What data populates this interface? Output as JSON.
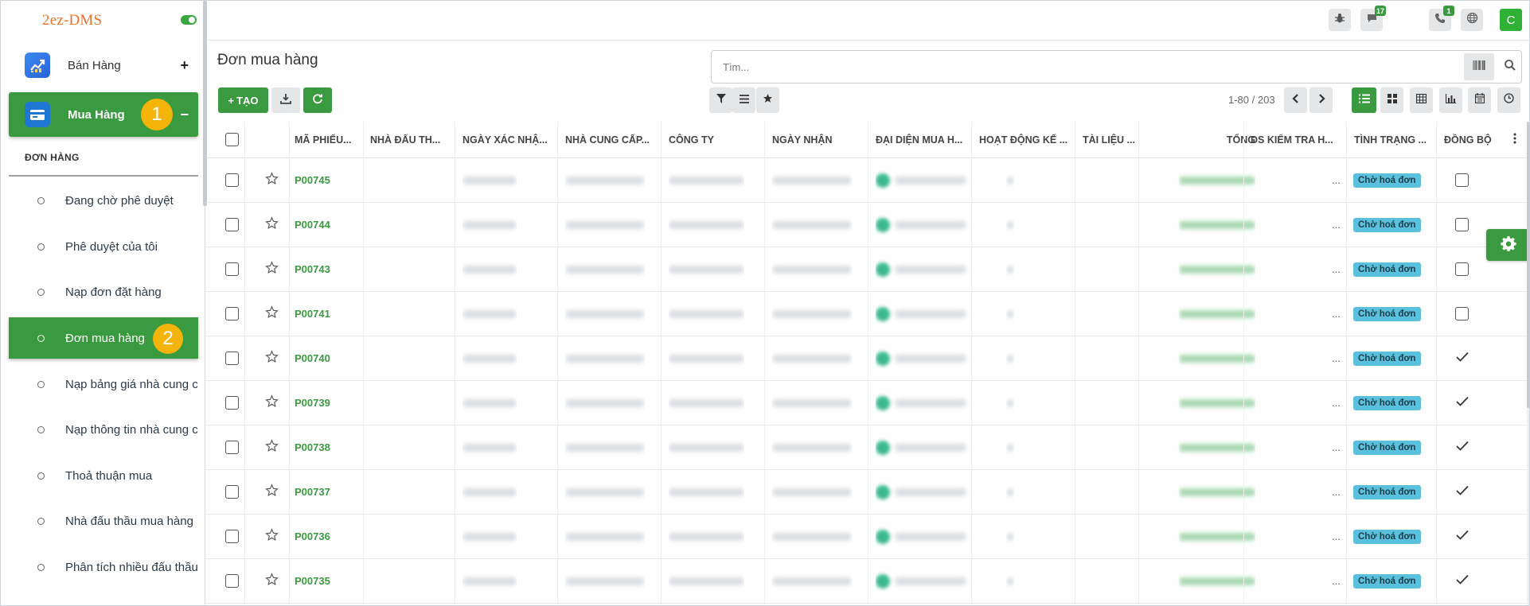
{
  "sidebar": {
    "logo": "2ez-DMS",
    "modules": [
      {
        "label": "Bán Hàng",
        "sign": "+"
      },
      {
        "label": "Mua Hàng",
        "sign": "−",
        "badge": "1"
      }
    ],
    "section_title": "ĐƠN HÀNG",
    "menu_items": [
      {
        "label": "Đang chờ phê duyệt"
      },
      {
        "label": "Phê duyệt của tôi"
      },
      {
        "label": "Nạp đơn đặt hàng"
      },
      {
        "label": "Đơn mua hàng",
        "badge": "2"
      },
      {
        "label": "Nạp bảng giá nhà cung cấp"
      },
      {
        "label": "Nạp thông tin nhà cung cấp"
      },
      {
        "label": "Thoả thuận mua"
      },
      {
        "label": "Nhà đấu thầu mua hàng"
      },
      {
        "label": "Phân tích nhiều đấu thầu"
      }
    ]
  },
  "topbar": {
    "chat_count": "17",
    "activity_count": "1",
    "avatar_letter": "C"
  },
  "control": {
    "page_title": "Đơn mua hàng",
    "search_placeholder": "Tìm...",
    "create_label": "TẠO",
    "pager_value": "1-80 / 203"
  },
  "table": {
    "columns": [
      "MÃ PHIẾU...",
      "NHÀ ĐẤU TH...",
      "NGÀY XÁC NHẬ...",
      "NHÀ CUNG CẤP...",
      "CÔNG TY",
      "NGÀY NHẬN",
      "ĐẠI DIỆN MUA H...",
      "HOẠT ĐỘNG KẾ ...",
      "TÀI LIỆU ...",
      "TỔNG",
      "DS KIỂM TRA H...",
      "TÌNH TRẠNG ...",
      "ĐỒNG BỘ"
    ],
    "rows": [
      {
        "code": "P00745",
        "dots": "...",
        "status": "Chờ hoá đơn",
        "synced": false
      },
      {
        "code": "P00744",
        "dots": "...",
        "status": "Chờ hoá đơn",
        "synced": false
      },
      {
        "code": "P00743",
        "dots": "...",
        "status": "Chờ hoá đơn",
        "synced": false
      },
      {
        "code": "P00741",
        "dots": "...",
        "status": "Chờ hoá đơn",
        "synced": false
      },
      {
        "code": "P00740",
        "dots": "...",
        "status": "Chờ hoá đơn",
        "synced": true
      },
      {
        "code": "P00739",
        "dots": "...",
        "status": "Chờ hoá đơn",
        "synced": true
      },
      {
        "code": "P00738",
        "dots": "...",
        "status": "Chờ hoá đơn",
        "synced": true
      },
      {
        "code": "P00737",
        "dots": "...",
        "status": "Chờ hoá đơn",
        "synced": true
      },
      {
        "code": "P00736",
        "dots": "...",
        "status": "Chờ hoá đơn",
        "synced": true
      },
      {
        "code": "P00735",
        "dots": "...",
        "status": "Chờ hoá đơn",
        "synced": true
      }
    ]
  },
  "colors": {
    "brand_green": "#3a9a3f",
    "badge_yellow": "#f5b40a",
    "status_blue": "#5bc0de",
    "logo_orange": "#e8732a"
  }
}
